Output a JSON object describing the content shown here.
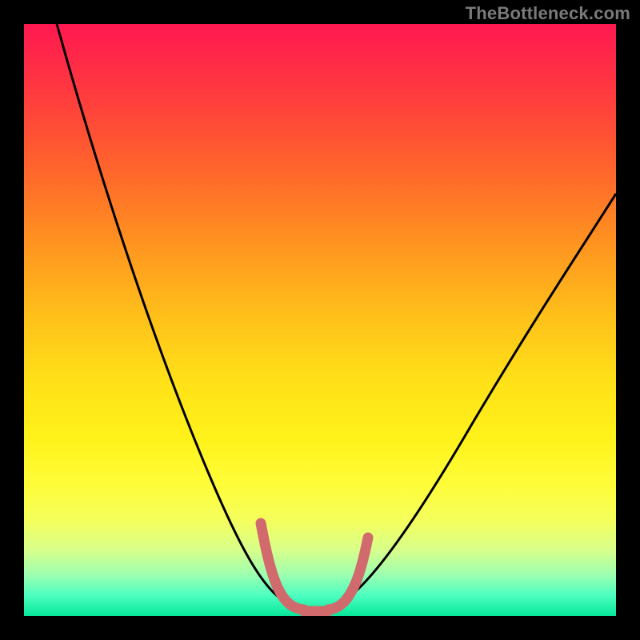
{
  "watermark": "TheBottleneck.com",
  "colors": {
    "background": "#000000",
    "curve": "#000000",
    "highlight": "#d06a6c",
    "gradient_top": "#ff1850",
    "gradient_bottom": "#06e79a"
  },
  "chart_data": {
    "type": "line",
    "title": "",
    "xlabel": "",
    "ylabel": "",
    "xlim": [
      0,
      100
    ],
    "ylim": [
      0,
      100
    ],
    "grid": false,
    "series": [
      {
        "name": "bottleneck-curve",
        "x": [
          0,
          5,
          10,
          15,
          20,
          25,
          30,
          35,
          40,
          45,
          48,
          50,
          52,
          55,
          60,
          65,
          70,
          75,
          80,
          85,
          90,
          95,
          100
        ],
        "y": [
          100,
          88,
          76,
          65,
          54,
          43,
          33,
          24,
          15,
          7,
          3,
          2,
          3,
          6,
          12,
          19,
          26,
          33,
          40,
          46,
          52,
          58,
          63
        ]
      },
      {
        "name": "optimal-highlight",
        "x": [
          40,
          42,
          44,
          46,
          48,
          50,
          52,
          54,
          56
        ],
        "y": [
          15,
          11,
          7,
          4,
          3,
          2,
          3,
          5,
          7
        ]
      }
    ],
    "annotations": []
  }
}
